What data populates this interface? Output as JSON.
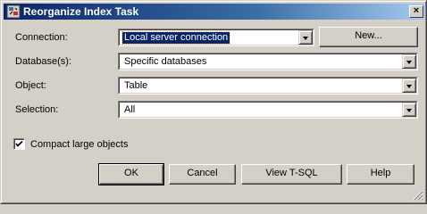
{
  "window": {
    "title": "Reorganize Index Task",
    "close_glyph": "×"
  },
  "fields": {
    "connection": {
      "label": "Connection:",
      "value": "Local server connection"
    },
    "database": {
      "label": "Database(s):",
      "value": "Specific databases"
    },
    "object": {
      "label": "Object:",
      "value": "Table"
    },
    "selection": {
      "label": "Selection:",
      "value": "All"
    }
  },
  "new_button": "New...",
  "compact": {
    "label": "Compact large objects",
    "checked": true
  },
  "buttons": {
    "ok": "OK",
    "cancel": "Cancel",
    "view_tsql": "View T-SQL",
    "help": "Help"
  },
  "icons": {
    "title": "task-icon",
    "close": "close-icon",
    "dropdown": "chevron-down-icon",
    "check": "checkmark-icon",
    "grip": "resize-grip-icon"
  }
}
